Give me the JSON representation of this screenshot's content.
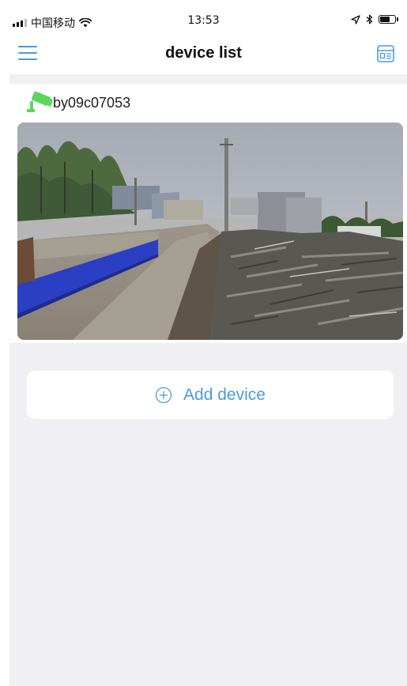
{
  "status_bar": {
    "carrier": "中国移动",
    "time": "13:53",
    "battery_level": 0.62
  },
  "nav": {
    "title": "device list"
  },
  "devices": [
    {
      "name": "by09c07053",
      "status_color": "#5bd65b"
    }
  ],
  "actions": {
    "add_device_label": "Add device"
  },
  "colors": {
    "accent": "#4a9ae0",
    "background": "#efeff4",
    "camera_green": "#5bd65b"
  },
  "icons": {
    "menu": "hamburger-menu-icon",
    "layout": "grid-layout-icon",
    "camera": "security-camera-icon",
    "add": "circle-plus-icon",
    "wifi": "wifi-icon",
    "location": "location-arrow-icon",
    "bluetooth": "bluetooth-icon",
    "battery": "battery-icon"
  }
}
